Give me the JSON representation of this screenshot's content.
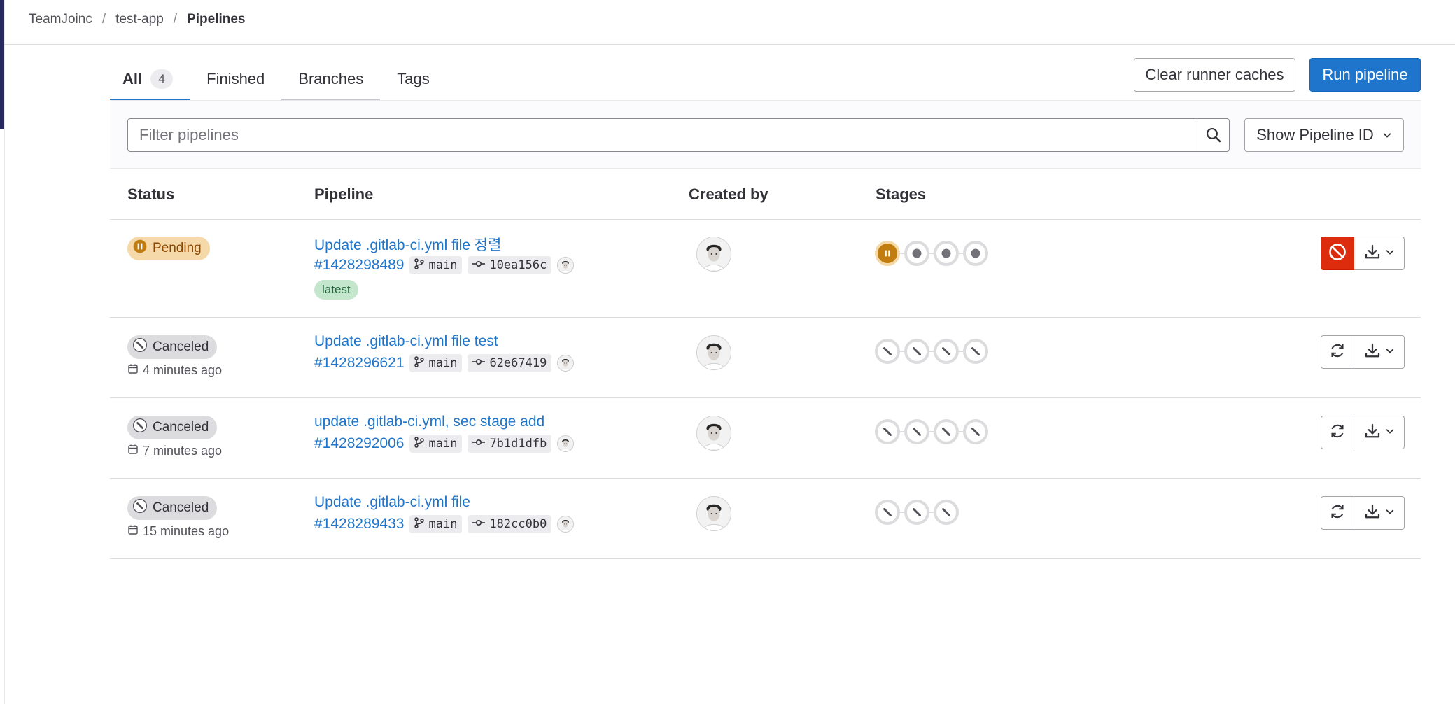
{
  "breadcrumb": [
    "TeamJoinc",
    "test-app",
    "Pipelines"
  ],
  "tabs": [
    {
      "label": "All",
      "count": "4",
      "active": true
    },
    {
      "label": "Finished"
    },
    {
      "label": "Branches"
    },
    {
      "label": "Tags"
    }
  ],
  "buttons": {
    "clear_caches": "Clear runner caches",
    "run_pipeline": "Run pipeline"
  },
  "filter": {
    "placeholder": "Filter pipelines",
    "show_id": "Show Pipeline ID"
  },
  "columns": {
    "status": "Status",
    "pipeline": "Pipeline",
    "created_by": "Created by",
    "stages": "Stages"
  },
  "pipelines": [
    {
      "status": "Pending",
      "time": "",
      "title": "Update .gitlab-ci.yml file 정렬",
      "id": "#1428298489",
      "branch": "main",
      "commit": "10ea156c",
      "latest": "latest",
      "stages": [
        "pending",
        "created",
        "created",
        "created"
      ],
      "action": "cancel"
    },
    {
      "status": "Canceled",
      "time": "4 minutes ago",
      "title": "Update .gitlab-ci.yml file test",
      "id": "#1428296621",
      "branch": "main",
      "commit": "62e67419",
      "stages": [
        "canceled",
        "canceled",
        "canceled",
        "canceled"
      ],
      "action": "retry"
    },
    {
      "status": "Canceled",
      "time": "7 minutes ago",
      "title": "update .gitlab-ci.yml, sec stage add",
      "id": "#1428292006",
      "branch": "main",
      "commit": "7b1d1dfb",
      "stages": [
        "canceled",
        "canceled",
        "canceled",
        "canceled"
      ],
      "action": "retry"
    },
    {
      "status": "Canceled",
      "time": "15 minutes ago",
      "title": "Update .gitlab-ci.yml file",
      "id": "#1428289433",
      "branch": "main",
      "commit": "182cc0b0",
      "stages": [
        "canceled",
        "canceled",
        "canceled"
      ],
      "action": "retry"
    }
  ],
  "colors": {
    "primary": "#1f75cb",
    "danger": "#dd2b0e",
    "pending": "#c17d10",
    "pending_bg": "#f5d9a8",
    "canceled": "#535158",
    "canceled_bg": "#dcdcde"
  }
}
